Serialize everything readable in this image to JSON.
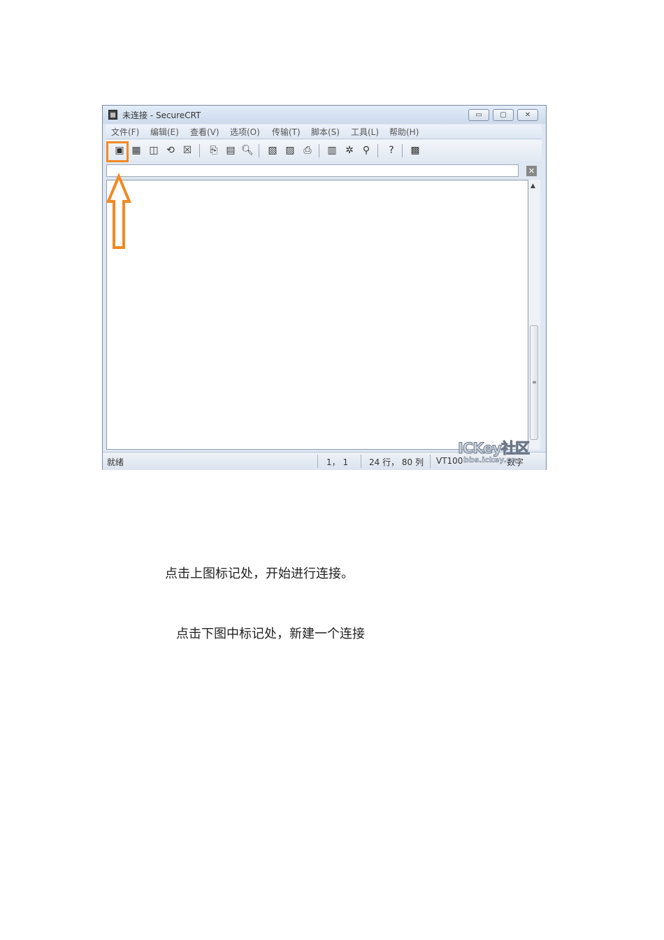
{
  "window": {
    "title": "未连接 - SecureCRT",
    "buttons": {
      "minimize": "▭",
      "maximize": "▢",
      "close": "✕"
    }
  },
  "menu": [
    "文件(F)",
    "编辑(E)",
    "查看(V)",
    "选项(O)",
    "传输(T)",
    "脚本(S)",
    "工具(L)",
    "帮助(H)"
  ],
  "toolbar": {
    "icons": [
      "connect-icon",
      "quick-connect-icon",
      "connect-in-tab-icon",
      "reconnect-icon",
      "disconnect-icon",
      "copy-icon",
      "paste-icon",
      "find-icon",
      "print-setup-icon",
      "print-selection-icon",
      "print-icon",
      "session-options-icon",
      "global-options-icon",
      "keymap-icon",
      "help-icon",
      "log-icon"
    ]
  },
  "addressbar": {
    "close_label": "✕"
  },
  "statusbar": {
    "status": "就绪",
    "position": "1， 1",
    "size": "24 行， 80 列",
    "emulation": "VT100",
    "mode": "数字"
  },
  "watermark": {
    "main": "ICKey社区",
    "sub": "bbs.ickey.cn"
  },
  "highlight": {
    "color": "#f08a24"
  },
  "captions": {
    "line1": "点击上图标记处，开始进行连接。",
    "line2": "点击下图中标记处，新建一个连接"
  }
}
